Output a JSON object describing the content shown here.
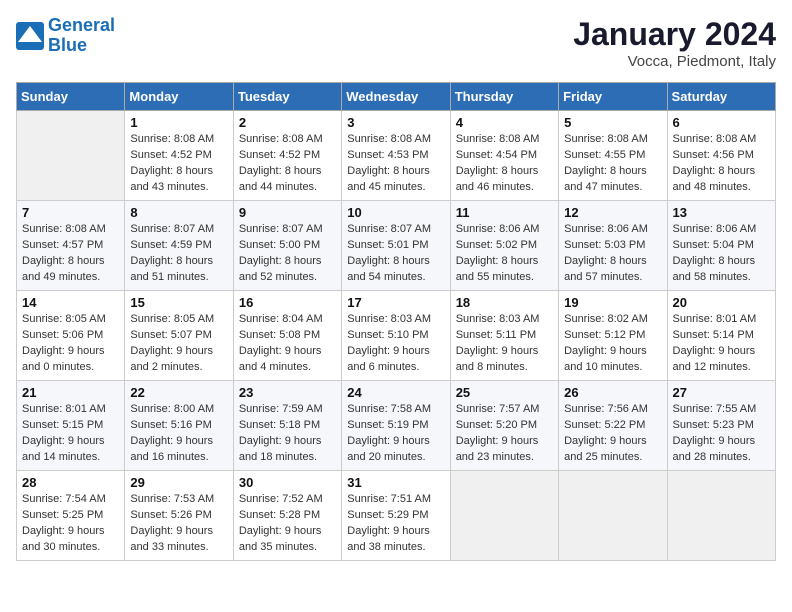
{
  "header": {
    "logo_line1": "General",
    "logo_line2": "Blue",
    "month": "January 2024",
    "location": "Vocca, Piedmont, Italy"
  },
  "weekdays": [
    "Sunday",
    "Monday",
    "Tuesday",
    "Wednesday",
    "Thursday",
    "Friday",
    "Saturday"
  ],
  "weeks": [
    [
      {
        "day": "",
        "info": ""
      },
      {
        "day": "1",
        "info": "Sunrise: 8:08 AM\nSunset: 4:52 PM\nDaylight: 8 hours\nand 43 minutes."
      },
      {
        "day": "2",
        "info": "Sunrise: 8:08 AM\nSunset: 4:52 PM\nDaylight: 8 hours\nand 44 minutes."
      },
      {
        "day": "3",
        "info": "Sunrise: 8:08 AM\nSunset: 4:53 PM\nDaylight: 8 hours\nand 45 minutes."
      },
      {
        "day": "4",
        "info": "Sunrise: 8:08 AM\nSunset: 4:54 PM\nDaylight: 8 hours\nand 46 minutes."
      },
      {
        "day": "5",
        "info": "Sunrise: 8:08 AM\nSunset: 4:55 PM\nDaylight: 8 hours\nand 47 minutes."
      },
      {
        "day": "6",
        "info": "Sunrise: 8:08 AM\nSunset: 4:56 PM\nDaylight: 8 hours\nand 48 minutes."
      }
    ],
    [
      {
        "day": "7",
        "info": "Sunrise: 8:08 AM\nSunset: 4:57 PM\nDaylight: 8 hours\nand 49 minutes."
      },
      {
        "day": "8",
        "info": "Sunrise: 8:07 AM\nSunset: 4:59 PM\nDaylight: 8 hours\nand 51 minutes."
      },
      {
        "day": "9",
        "info": "Sunrise: 8:07 AM\nSunset: 5:00 PM\nDaylight: 8 hours\nand 52 minutes."
      },
      {
        "day": "10",
        "info": "Sunrise: 8:07 AM\nSunset: 5:01 PM\nDaylight: 8 hours\nand 54 minutes."
      },
      {
        "day": "11",
        "info": "Sunrise: 8:06 AM\nSunset: 5:02 PM\nDaylight: 8 hours\nand 55 minutes."
      },
      {
        "day": "12",
        "info": "Sunrise: 8:06 AM\nSunset: 5:03 PM\nDaylight: 8 hours\nand 57 minutes."
      },
      {
        "day": "13",
        "info": "Sunrise: 8:06 AM\nSunset: 5:04 PM\nDaylight: 8 hours\nand 58 minutes."
      }
    ],
    [
      {
        "day": "14",
        "info": "Sunrise: 8:05 AM\nSunset: 5:06 PM\nDaylight: 9 hours\nand 0 minutes."
      },
      {
        "day": "15",
        "info": "Sunrise: 8:05 AM\nSunset: 5:07 PM\nDaylight: 9 hours\nand 2 minutes."
      },
      {
        "day": "16",
        "info": "Sunrise: 8:04 AM\nSunset: 5:08 PM\nDaylight: 9 hours\nand 4 minutes."
      },
      {
        "day": "17",
        "info": "Sunrise: 8:03 AM\nSunset: 5:10 PM\nDaylight: 9 hours\nand 6 minutes."
      },
      {
        "day": "18",
        "info": "Sunrise: 8:03 AM\nSunset: 5:11 PM\nDaylight: 9 hours\nand 8 minutes."
      },
      {
        "day": "19",
        "info": "Sunrise: 8:02 AM\nSunset: 5:12 PM\nDaylight: 9 hours\nand 10 minutes."
      },
      {
        "day": "20",
        "info": "Sunrise: 8:01 AM\nSunset: 5:14 PM\nDaylight: 9 hours\nand 12 minutes."
      }
    ],
    [
      {
        "day": "21",
        "info": "Sunrise: 8:01 AM\nSunset: 5:15 PM\nDaylight: 9 hours\nand 14 minutes."
      },
      {
        "day": "22",
        "info": "Sunrise: 8:00 AM\nSunset: 5:16 PM\nDaylight: 9 hours\nand 16 minutes."
      },
      {
        "day": "23",
        "info": "Sunrise: 7:59 AM\nSunset: 5:18 PM\nDaylight: 9 hours\nand 18 minutes."
      },
      {
        "day": "24",
        "info": "Sunrise: 7:58 AM\nSunset: 5:19 PM\nDaylight: 9 hours\nand 20 minutes."
      },
      {
        "day": "25",
        "info": "Sunrise: 7:57 AM\nSunset: 5:20 PM\nDaylight: 9 hours\nand 23 minutes."
      },
      {
        "day": "26",
        "info": "Sunrise: 7:56 AM\nSunset: 5:22 PM\nDaylight: 9 hours\nand 25 minutes."
      },
      {
        "day": "27",
        "info": "Sunrise: 7:55 AM\nSunset: 5:23 PM\nDaylight: 9 hours\nand 28 minutes."
      }
    ],
    [
      {
        "day": "28",
        "info": "Sunrise: 7:54 AM\nSunset: 5:25 PM\nDaylight: 9 hours\nand 30 minutes."
      },
      {
        "day": "29",
        "info": "Sunrise: 7:53 AM\nSunset: 5:26 PM\nDaylight: 9 hours\nand 33 minutes."
      },
      {
        "day": "30",
        "info": "Sunrise: 7:52 AM\nSunset: 5:28 PM\nDaylight: 9 hours\nand 35 minutes."
      },
      {
        "day": "31",
        "info": "Sunrise: 7:51 AM\nSunset: 5:29 PM\nDaylight: 9 hours\nand 38 minutes."
      },
      {
        "day": "",
        "info": ""
      },
      {
        "day": "",
        "info": ""
      },
      {
        "day": "",
        "info": ""
      }
    ]
  ]
}
